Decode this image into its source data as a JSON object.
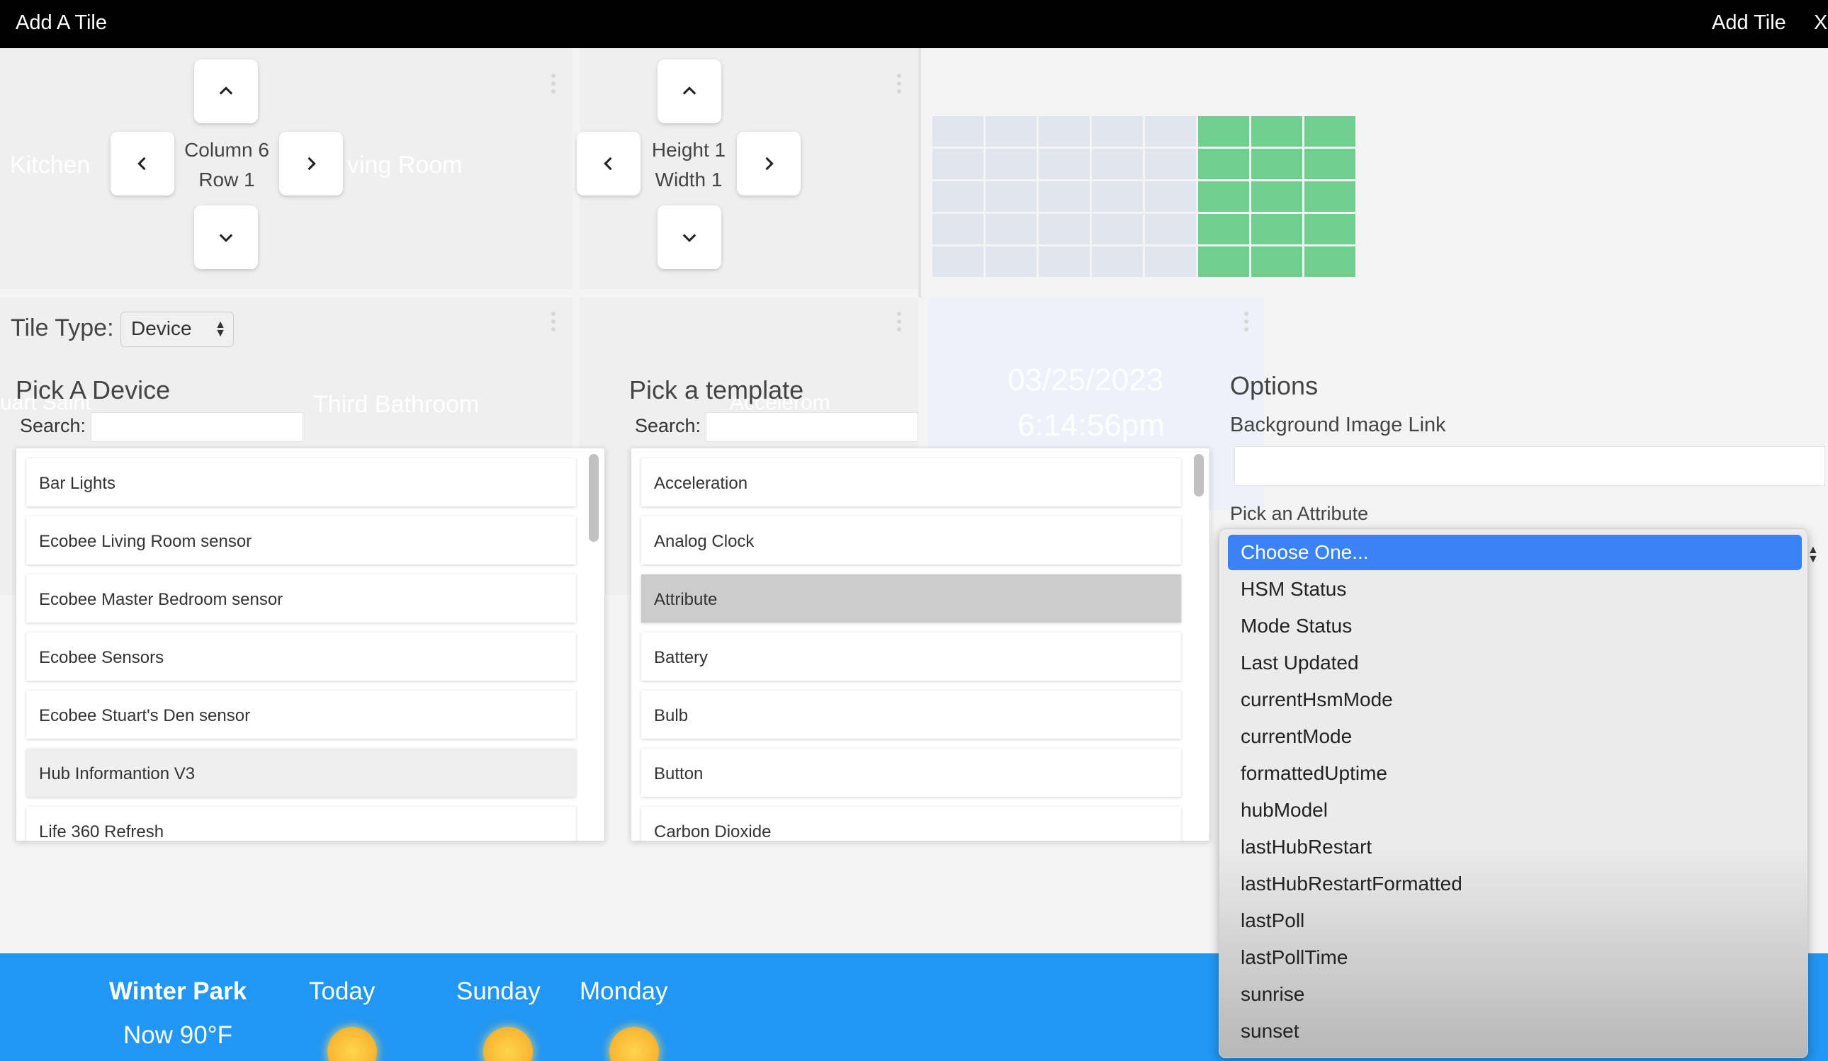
{
  "topbar": {
    "title": "Add A Tile",
    "add_label": "Add Tile",
    "close_label": "X"
  },
  "background_dashboard": {
    "tile_kitchen": "Kitchen",
    "tile_living_room": "ving Room",
    "tile_third_bathroom": "Third Bathroom",
    "tile_left_partial": "uart Saint",
    "tile_behind_template": "Accelerom",
    "date": "03/25/2023",
    "time": "6:14:56pm"
  },
  "position_control": {
    "line1": "Column 6",
    "line2": "Row 1"
  },
  "size_control": {
    "line1": "Height 1",
    "line2": "Width 1"
  },
  "grid": {
    "rows": [
      [
        false,
        false,
        false,
        false,
        false,
        true,
        true,
        true
      ],
      [
        false,
        false,
        false,
        false,
        false,
        true,
        true,
        true
      ],
      [
        false,
        false,
        false,
        false,
        false,
        true,
        true,
        true
      ],
      [
        false,
        false,
        false,
        false,
        false,
        true,
        true,
        true
      ],
      [
        false,
        false,
        false,
        false,
        false,
        true,
        true,
        true
      ]
    ]
  },
  "tile_type": {
    "label": "Tile Type:",
    "value": "Device"
  },
  "device_picker": {
    "title": "Pick A Device",
    "search_label": "Search:",
    "items": [
      "Bar Lights",
      "Ecobee Living Room sensor",
      "Ecobee Master Bedroom sensor",
      "Ecobee Sensors",
      "Ecobee Stuart's Den sensor",
      "Hub Informantion V3",
      "Life 360 Refresh"
    ],
    "highlighted": "Hub Informantion V3"
  },
  "template_picker": {
    "title": "Pick a template",
    "search_label": "Search:",
    "items": [
      "Acceleration",
      "Analog Clock",
      "Attribute",
      "Battery",
      "Bulb",
      "Button",
      "Carbon Dioxide"
    ],
    "selected": "Attribute"
  },
  "options": {
    "title": "Options",
    "bg_image_label": "Background Image Link",
    "attribute_label": "Pick an Attribute",
    "attribute_options": [
      "Choose One...",
      "HSM Status",
      "Mode Status",
      "Last Updated",
      "currentHsmMode",
      "currentMode",
      "formattedUptime",
      "hubModel",
      "lastHubRestart",
      "lastHubRestartFormatted",
      "lastPoll",
      "lastPollTime",
      "sunrise",
      "sunset"
    ],
    "selected_attribute": "Choose One..."
  },
  "weather": {
    "location": "Winter Park",
    "now": "Now 90°F",
    "days": [
      "Today",
      "Sunday",
      "Monday"
    ]
  },
  "colors": {
    "topbar": "#000000",
    "grid_on": "#6ecf8e",
    "grid_off": "#e1e6ee",
    "dropdown_selected": "#3b82f6",
    "weather_bg": "#2196f3"
  }
}
